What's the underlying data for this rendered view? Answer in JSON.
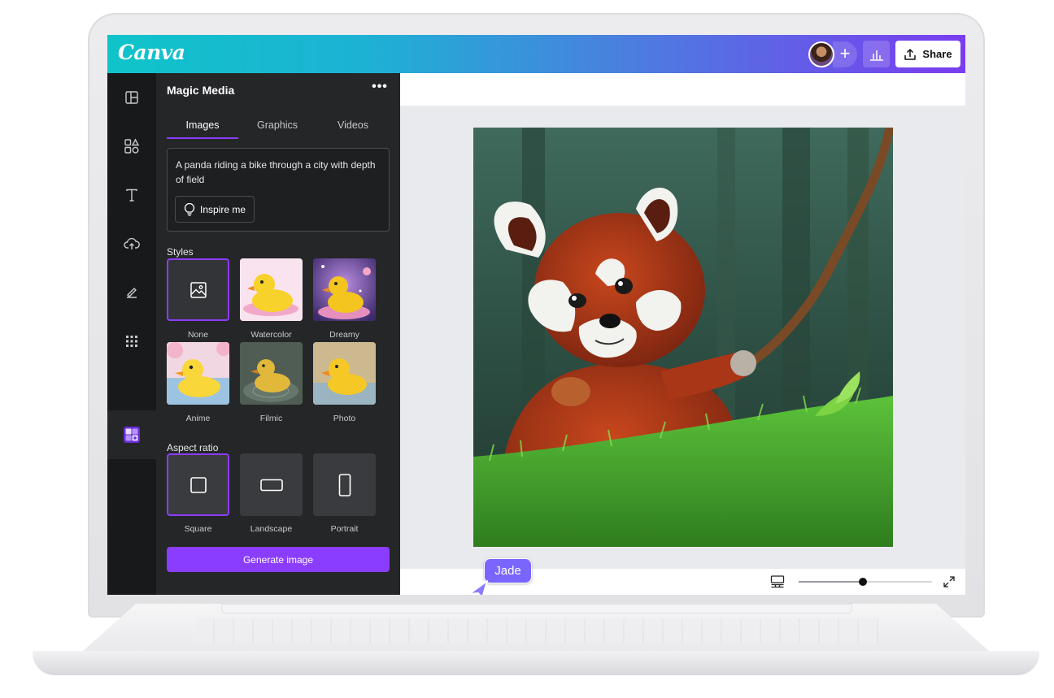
{
  "app": {
    "logo": "Canva"
  },
  "header": {
    "share_label": "Share",
    "add_label": "+"
  },
  "rail": {
    "items": [
      {
        "icon": "design-layout-icon"
      },
      {
        "icon": "elements-icon"
      },
      {
        "icon": "text-icon"
      },
      {
        "icon": "uploads-icon"
      },
      {
        "icon": "draw-icon"
      },
      {
        "icon": "apps-grid-icon"
      },
      {
        "icon": "magic-media-app-icon",
        "active": true
      }
    ]
  },
  "panel": {
    "title": "Magic Media",
    "more": "•••",
    "tabs": [
      {
        "label": "Images",
        "active": true
      },
      {
        "label": "Graphics"
      },
      {
        "label": "Videos"
      }
    ],
    "prompt": "A panda riding a bike through a city with depth of field",
    "inspire_label": "Inspire me",
    "styles_label": "Styles",
    "styles": [
      {
        "label": "None",
        "selected": true
      },
      {
        "label": "Watercolor"
      },
      {
        "label": "Dreamy"
      },
      {
        "label": "Anime"
      },
      {
        "label": "Filmic"
      },
      {
        "label": "Photo"
      }
    ],
    "aspect_label": "Aspect ratio",
    "aspects": [
      {
        "label": "Square",
        "selected": true
      },
      {
        "label": "Landscape"
      },
      {
        "label": "Portrait"
      }
    ],
    "generate_label": "Generate image"
  },
  "collaborator": {
    "name": "Jade"
  },
  "colors": {
    "accent": "#8b3dff",
    "panel": "#252628",
    "rail": "#18191b",
    "cursor": "#7a66ff"
  }
}
